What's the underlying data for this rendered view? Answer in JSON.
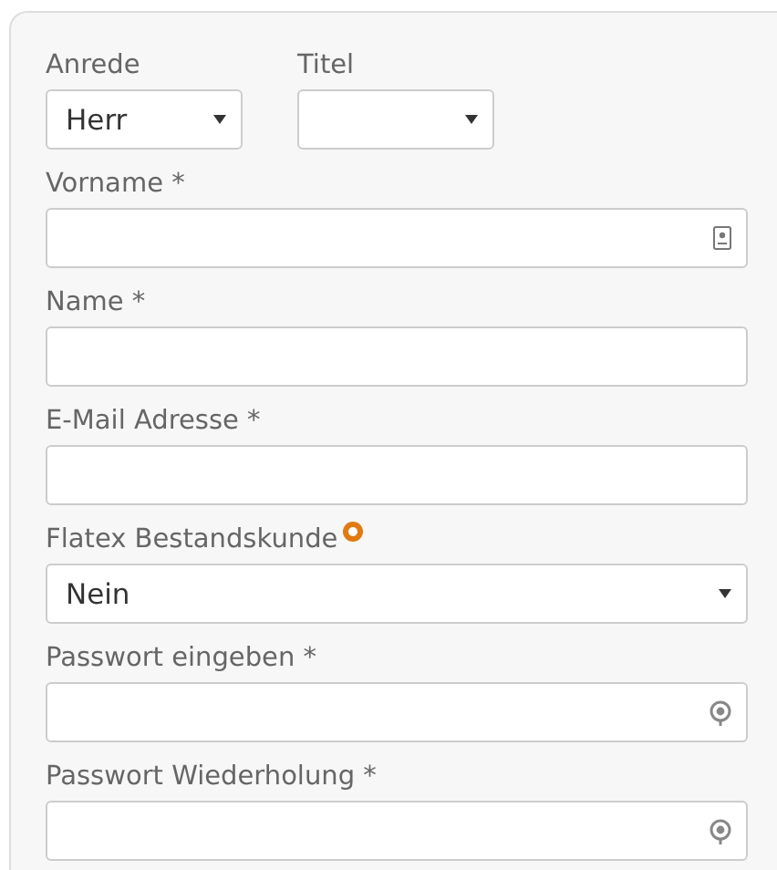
{
  "top_row": [
    {
      "label": "Anrede",
      "kind": "select",
      "value": "Herr"
    },
    {
      "label": "Titel",
      "kind": "select"
    }
  ],
  "fields": [
    {
      "label": "Vorname *",
      "kind": "contact"
    },
    {
      "label": "Name *",
      "kind": "text"
    },
    {
      "label": "E-Mail Adresse *",
      "kind": "text"
    },
    {
      "label": "Flatex Bestandskunde",
      "kind": "select",
      "value": "Nein",
      "help": true
    },
    {
      "label": "Passwort eingeben *",
      "kind": "password"
    },
    {
      "label": "Passwort Wiederholung *",
      "kind": "password"
    }
  ]
}
